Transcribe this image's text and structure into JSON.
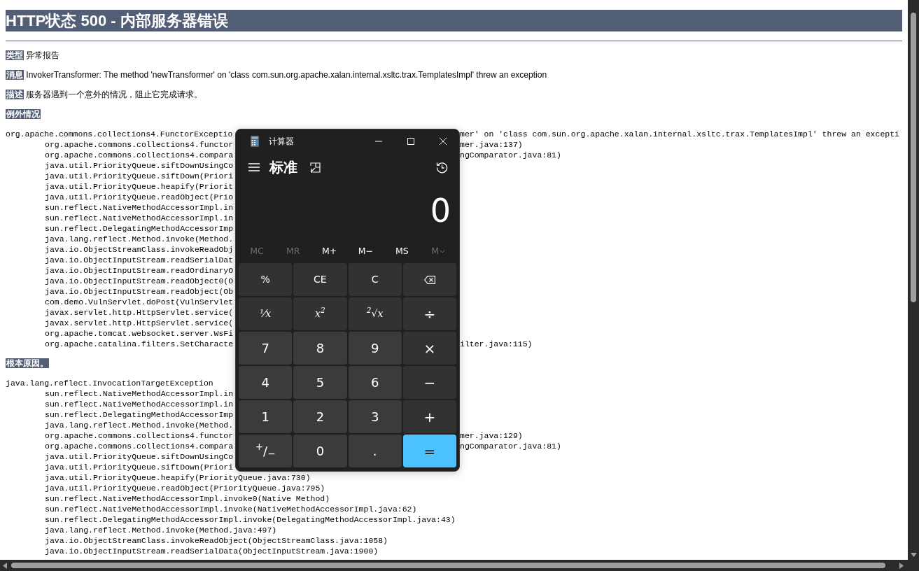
{
  "page": {
    "title": "HTTP状态 500 - 内部服务器错误",
    "fields": [
      {
        "label": "类型",
        "value": "异常报告"
      },
      {
        "label": "消息",
        "value": "InvokerTransformer: The method 'newTransformer' on 'class com.sun.org.apache.xalan.internal.xsltc.trax.TemplatesImpl' threw an exception"
      },
      {
        "label": "描述",
        "value": "服务器遇到一个意外的情况，阻止它完成请求。"
      }
    ],
    "sections": [
      {
        "heading": "例外情况",
        "trace": [
          {
            "text": "org.apache.commons.collections4.FunctorExceptio",
            "indented": false,
            "tail": "mer' on 'class com.sun.org.apache.xalan.internal.xsltc.trax.TemplatesImpl' threw an excepti"
          },
          {
            "text": "org.apache.commons.collections4.functor",
            "indented": true,
            "tail": "mer.java:137)"
          },
          {
            "text": "org.apache.commons.collections4.compara",
            "indented": true,
            "tail": "ngComparator.java:81)"
          },
          {
            "text": "java.util.PriorityQueue.siftDownUsingCo",
            "indented": true
          },
          {
            "text": "java.util.PriorityQueue.siftDown(Priori",
            "indented": true
          },
          {
            "text": "java.util.PriorityQueue.heapify(Priorit",
            "indented": true
          },
          {
            "text": "java.util.PriorityQueue.readObject(Prio",
            "indented": true
          },
          {
            "text": "sun.reflect.NativeMethodAccessorImpl.in",
            "indented": true
          },
          {
            "text": "sun.reflect.NativeMethodAccessorImpl.in",
            "indented": true
          },
          {
            "text": "sun.reflect.DelegatingMethodAccessorImp",
            "indented": true
          },
          {
            "text": "java.lang.reflect.Method.invoke(Method.",
            "indented": true
          },
          {
            "text": "java.io.ObjectStreamClass.invokeReadObj",
            "indented": true
          },
          {
            "text": "java.io.ObjectInputStream.readSerialDat",
            "indented": true
          },
          {
            "text": "java.io.ObjectInputStream.readOrdinaryO",
            "indented": true
          },
          {
            "text": "java.io.ObjectInputStream.readObject0(O",
            "indented": true
          },
          {
            "text": "java.io.ObjectInputStream.readObject(Ob",
            "indented": true
          },
          {
            "text": "com.demo.VulnServlet.doPost(VulnServlet",
            "indented": true
          },
          {
            "text": "javax.servlet.http.HttpServlet.service(",
            "indented": true
          },
          {
            "text": "javax.servlet.http.HttpServlet.service(",
            "indented": true
          },
          {
            "text": "org.apache.tomcat.websocket.server.WsFi",
            "indented": true
          },
          {
            "text": "org.apache.catalina.filters.SetCharacte",
            "indented": true,
            "tail": "ilter.java:115)"
          }
        ]
      },
      {
        "heading": "根本原因。",
        "trace": [
          {
            "text": "java.lang.reflect.InvocationTargetException",
            "indented": false
          },
          {
            "text": "sun.reflect.NativeMethodAccessorImpl.in",
            "indented": true
          },
          {
            "text": "sun.reflect.NativeMethodAccessorImpl.in",
            "indented": true
          },
          {
            "text": "sun.reflect.DelegatingMethodAccessorImp",
            "indented": true
          },
          {
            "text": "java.lang.reflect.Method.invoke(Method.",
            "indented": true
          },
          {
            "text": "org.apache.commons.collections4.functor",
            "indented": true,
            "tail": "mer.java:129)"
          },
          {
            "text": "org.apache.commons.collections4.compara",
            "indented": true,
            "tail": "ngComparator.java:81)"
          },
          {
            "text": "java.util.PriorityQueue.siftDownUsingCo",
            "indented": true
          },
          {
            "text": "java.util.PriorityQueue.siftDown(Priori",
            "indented": true
          },
          {
            "text": "java.util.PriorityQueue.heapify(PriorityQueue.java:730)",
            "indented": true
          },
          {
            "text": "java.util.PriorityQueue.readObject(PriorityQueue.java:795)",
            "indented": true
          },
          {
            "text": "sun.reflect.NativeMethodAccessorImpl.invoke0(Native Method)",
            "indented": true
          },
          {
            "text": "sun.reflect.NativeMethodAccessorImpl.invoke(NativeMethodAccessorImpl.java:62)",
            "indented": true
          },
          {
            "text": "sun.reflect.DelegatingMethodAccessorImpl.invoke(DelegatingMethodAccessorImpl.java:43)",
            "indented": true
          },
          {
            "text": "java.lang.reflect.Method.invoke(Method.java:497)",
            "indented": true
          },
          {
            "text": "java.io.ObjectStreamClass.invokeReadObject(ObjectStreamClass.java:1058)",
            "indented": true
          },
          {
            "text": "java.io.ObjectInputStream.readSerialData(ObjectInputStream.java:1900)",
            "indented": true
          }
        ]
      }
    ]
  },
  "calculator": {
    "title": "计算器",
    "mode": "标准",
    "display": "0",
    "memory_buttons": [
      {
        "label": "MC",
        "disabled": true,
        "kind": "plain"
      },
      {
        "label": "MR",
        "disabled": true,
        "kind": "plain"
      },
      {
        "label": "M+",
        "disabled": false,
        "kind": "plain"
      },
      {
        "label": "M−",
        "disabled": false,
        "kind": "plain"
      },
      {
        "label": "MS",
        "disabled": false,
        "kind": "plain"
      },
      {
        "label": "M",
        "disabled": true,
        "kind": "dropdown"
      }
    ],
    "keys": [
      {
        "label": "%",
        "kind": "function"
      },
      {
        "label": "CE",
        "kind": "function"
      },
      {
        "label": "C",
        "kind": "function"
      },
      {
        "kind": "backspace"
      },
      {
        "label": "⅟x",
        "kind": "function"
      },
      {
        "label": "x$^{2}$",
        "kind": "function"
      },
      {
        "label": "$^{2}$√x",
        "kind": "function"
      },
      {
        "label": "÷",
        "kind": "operator"
      },
      {
        "label": "7",
        "kind": "digit"
      },
      {
        "label": "8",
        "kind": "digit"
      },
      {
        "label": "9",
        "kind": "digit"
      },
      {
        "label": "×",
        "kind": "operator"
      },
      {
        "label": "4",
        "kind": "digit"
      },
      {
        "label": "5",
        "kind": "digit"
      },
      {
        "label": "6",
        "kind": "digit"
      },
      {
        "label": "−",
        "kind": "operator"
      },
      {
        "label": "1",
        "kind": "digit"
      },
      {
        "label": "2",
        "kind": "digit"
      },
      {
        "label": "3",
        "kind": "digit"
      },
      {
        "label": "+",
        "kind": "operator"
      },
      {
        "label": "$^{+}$/$_{−}$",
        "kind": "digit"
      },
      {
        "label": "0",
        "kind": "digit"
      },
      {
        "label": ".",
        "kind": "digit"
      },
      {
        "label": "=",
        "kind": "equals"
      }
    ]
  }
}
